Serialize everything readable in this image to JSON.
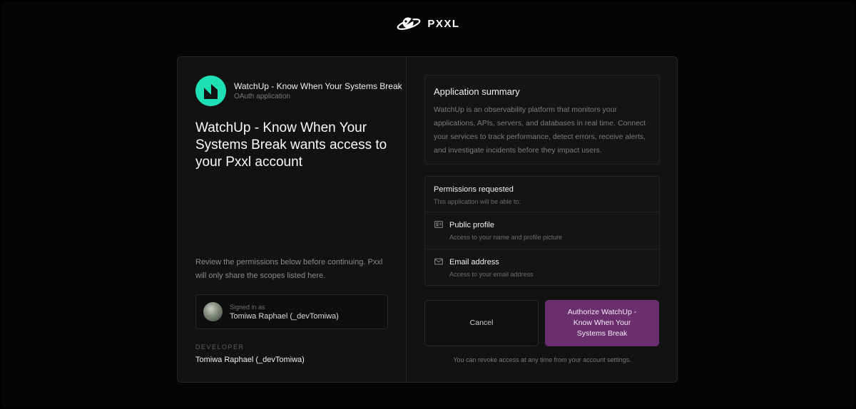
{
  "brand": {
    "name": "PXXL",
    "icon": "planet-rocket-icon"
  },
  "app": {
    "name": "WatchUp - Know When Your Systems Break",
    "type_label": "OAuth application",
    "logo_color": "#1fe0b4"
  },
  "headline": "WatchUp - Know When Your Systems Break wants access to your Pxxl account",
  "review_text": "Review the permissions below before continuing. Pxxl will only share the scopes listed here.",
  "signed_in": {
    "caption": "Signed in as",
    "user": "Tomiwa Raphael (_devTomiwa)"
  },
  "developer": {
    "label": "DEVELOPER",
    "name": "Tomiwa Raphael (_devTomiwa)"
  },
  "summary": {
    "title": "Application summary",
    "body": "WatchUp is an observability platform that monitors your applications, APIs, servers, and databases in real time. Connect your services to track performance, detect errors, receive alerts, and investigate incidents before they impact users."
  },
  "permissions": {
    "title": "Permissions requested",
    "subtitle": "This application will be able to:",
    "items": [
      {
        "label": "Public profile",
        "description": "Access to your name and profile picture",
        "icon": "id-card-icon"
      },
      {
        "label": "Email address",
        "description": "Access to your email address",
        "icon": "mail-icon"
      }
    ]
  },
  "actions": {
    "cancel_label": "Cancel",
    "authorize_label": "Authorize WatchUp - Know When Your Systems Break",
    "accent_color": "#6b2e6e"
  },
  "revoke_note": "You can revoke access at any time from your account settings."
}
